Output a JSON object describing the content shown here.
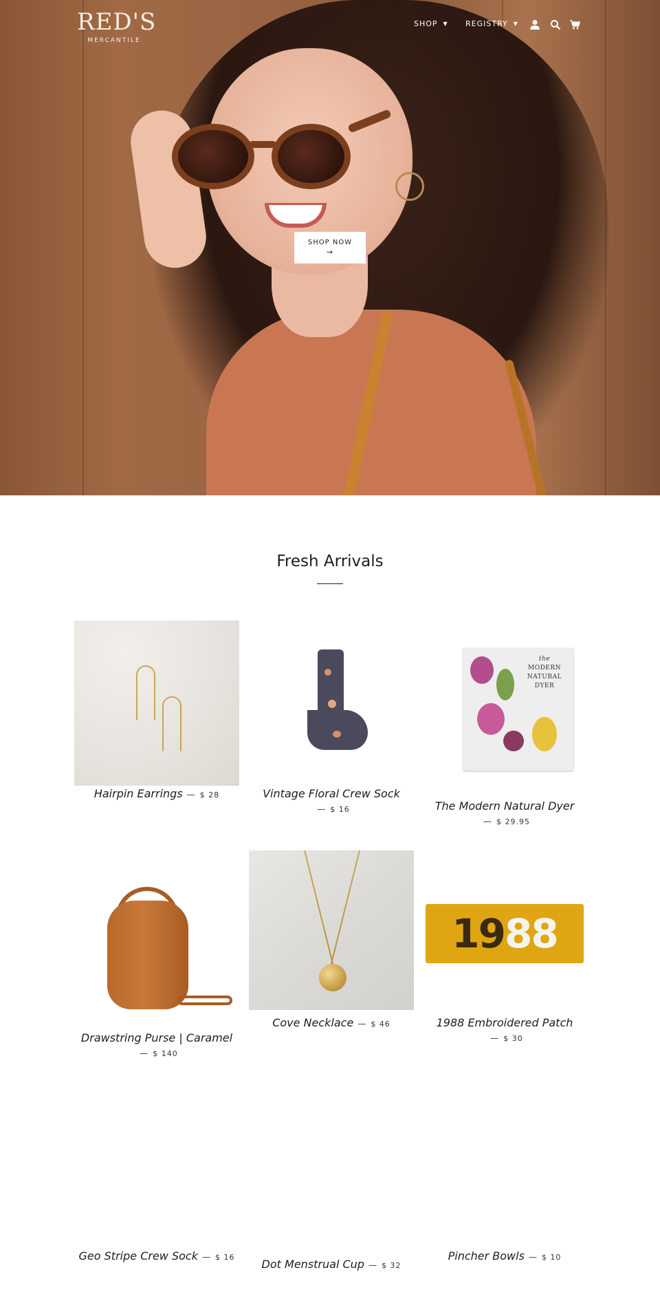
{
  "header": {
    "logo_brand": "RED'S",
    "logo_sub": "MERCANTILE",
    "nav": [
      {
        "label": "SHOP"
      },
      {
        "label": "REGISTRY"
      }
    ],
    "icons": [
      "account-icon",
      "search-icon",
      "cart-icon"
    ]
  },
  "hero": {
    "cta_label": "SHOP NOW",
    "cta_arrow": "→"
  },
  "section": {
    "title": "Fresh Arrivals"
  },
  "products": [
    {
      "name": "Hairpin Earrings",
      "price": "$ 28"
    },
    {
      "name": "Vintage Floral Crew Sock",
      "price": "$ 16"
    },
    {
      "name": "The Modern Natural Dyer",
      "price": "$ 29.95"
    },
    {
      "name": "Drawstring Purse | Caramel",
      "price": "$ 140"
    },
    {
      "name": "Cove Necklace",
      "price": "$ 46"
    },
    {
      "name": "1988 Embroidered Patch",
      "price": "$ 30"
    },
    {
      "name": "Geo Stripe Crew Sock",
      "price": "$ 16"
    },
    {
      "name": "Dot Menstrual Cup",
      "price": "$ 32"
    },
    {
      "name": "Pincher Bowls",
      "price": "$ 10"
    }
  ],
  "book_cover": {
    "line1": "the",
    "line2": "MODERN",
    "line3": "NATURAL",
    "line4": "DYER"
  },
  "patch": {
    "dark_digits": "19",
    "light_digits": "88"
  },
  "dash": "—",
  "colors": {
    "text": "#1c1d1d",
    "hero_tone": "#9a6444",
    "patch_yellow": "#e0a512",
    "purse_caramel": "#b8682b"
  }
}
